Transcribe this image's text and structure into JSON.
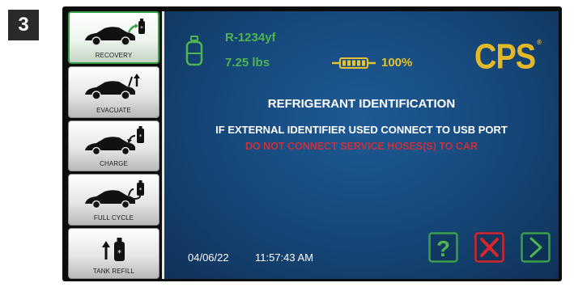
{
  "step_number": "3",
  "sidebar": {
    "items": [
      {
        "label": "RECOVERY",
        "icon": "car-recovery-icon",
        "active": true
      },
      {
        "label": "EVACUATE",
        "icon": "car-evacuate-icon",
        "active": false
      },
      {
        "label": "CHARGE",
        "icon": "car-charge-icon",
        "active": false
      },
      {
        "label": "FULL CYCLE",
        "icon": "car-full-cycle-icon",
        "active": false
      },
      {
        "label": "TANK REFILL",
        "icon": "tank-refill-icon",
        "active": false
      }
    ]
  },
  "status": {
    "refrigerant": "R-1234yf",
    "weight": "7.25 lbs",
    "battery_percent": "100%",
    "tank_icon": "refrigerant-tank-icon",
    "battery_icon": "battery-icon"
  },
  "brand": {
    "logo": "CPS"
  },
  "message": {
    "title": "REFRIGERANT IDENTIFICATION",
    "line1": "IF EXTERNAL IDENTIFIER USED CONNECT TO USB PORT",
    "line2": "DO NOT CONNECT SERVICE HOSES(S) TO CAR"
  },
  "footer": {
    "date": "04/06/22",
    "time": "11:57:43 AM"
  },
  "actions": {
    "help_icon": "help-icon",
    "cancel_icon": "cancel-x-icon",
    "next_icon": "next-arrow-icon"
  },
  "colors": {
    "screen_blue": "#174a7e",
    "status_green": "#4fb34f",
    "battery_yellow": "#e6c12b",
    "brand_gold": "#e3b92a",
    "warning_red": "#c9303a",
    "cancel_red": "#d8252a",
    "active_border_green": "#3aa04a"
  }
}
